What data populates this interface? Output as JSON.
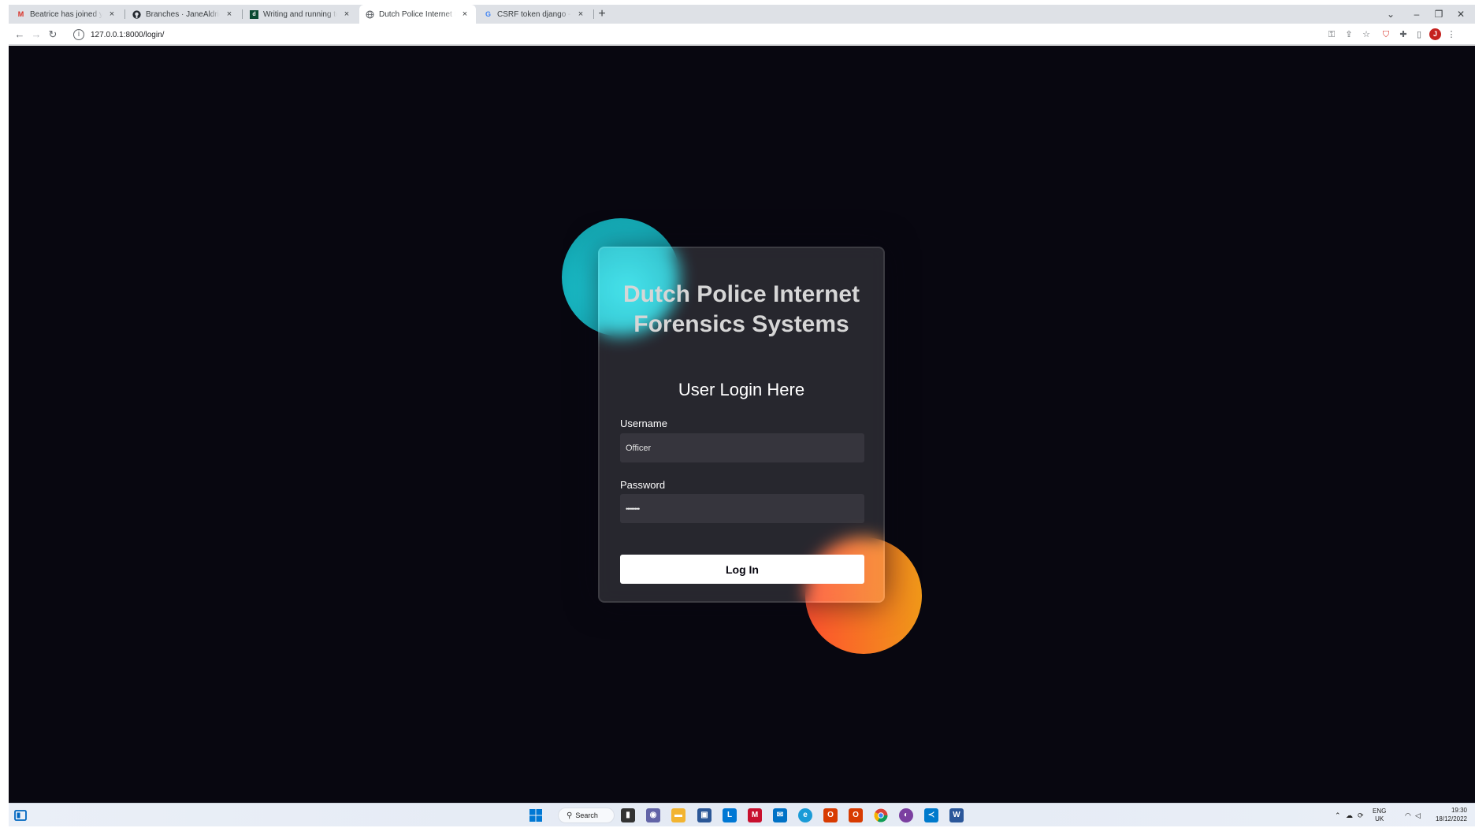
{
  "browser": {
    "tabs": [
      {
        "title": "Beatrice has joined your Personal",
        "favicon": "gmail-icon",
        "favicon_color": "#d93025",
        "active": false
      },
      {
        "title": "Branches · JaneAldridge/Django",
        "favicon": "github-icon",
        "favicon_color": "#24292f",
        "active": false
      },
      {
        "title": "Writing and running tests | Django",
        "favicon": "django-icon",
        "favicon_color": "#0c4b33",
        "active": false
      },
      {
        "title": "Dutch Police Internet Forensics S",
        "favicon": "globe-icon",
        "favicon_color": "#5f6368",
        "active": true
      },
      {
        "title": "CSRF token django - Google Sea",
        "favicon": "google-icon",
        "favicon_color": "#4285f4",
        "active": false
      }
    ],
    "close_glyph": "×",
    "new_tab_glyph": "+",
    "url": "127.0.0.1:8000/login/",
    "profile_initial": "J"
  },
  "page": {
    "title": "Dutch Police Internet Forensics Systems",
    "subtitle": "User Login Here",
    "username_label": "Username",
    "username_value": "Officer",
    "password_label": "Password",
    "password_value": "••••••••",
    "login_button": "Log In"
  },
  "taskbar": {
    "search_label": "Search",
    "language": "ENG",
    "region": "UK",
    "time": "19:30",
    "date": "18/12/2022"
  },
  "colors": {
    "page_background": "#080710",
    "shape_teal": "#1bc3cf",
    "shape_orange_start": "#ff512f",
    "shape_orange_end": "#f09819",
    "button_background": "#ffffff"
  }
}
